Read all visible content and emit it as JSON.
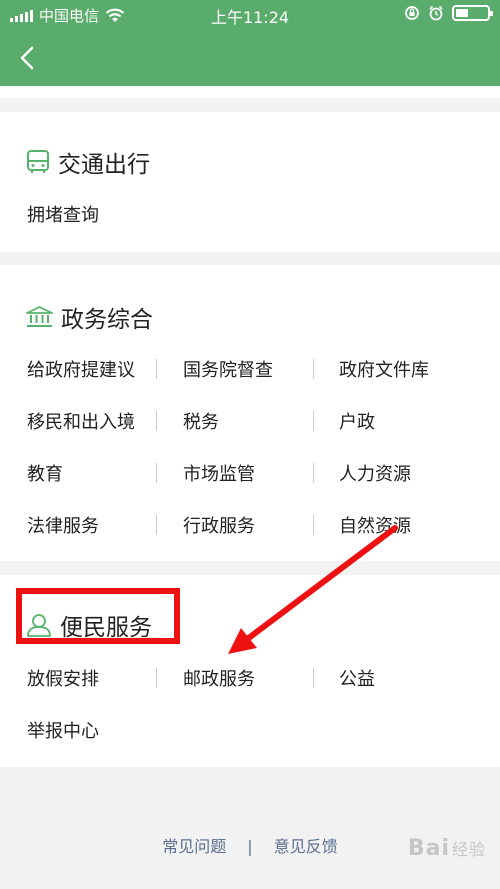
{
  "status_bar": {
    "carrier": "中国电信",
    "time": "上午11:24",
    "battery_level": 0.4
  },
  "sections": {
    "traffic": {
      "title": "交通出行",
      "items": [
        "拥堵查询"
      ]
    },
    "gov": {
      "title": "政务综合",
      "items": [
        "给政府提建议",
        "国务院督查",
        "政府文件库",
        "移民和出入境",
        "税务",
        "户政",
        "教育",
        "市场监管",
        "人力资源",
        "法律服务",
        "行政服务",
        "自然资源"
      ]
    },
    "civil": {
      "title": "便民服务",
      "items": [
        "放假安排",
        "邮政服务",
        "公益",
        "举报中心"
      ]
    }
  },
  "footer": {
    "faq": "常见问题",
    "separator": "|",
    "feedback": "意见反馈"
  },
  "watermark": {
    "text": "Bai",
    "suffix": "经验"
  },
  "colors": {
    "header_green": "#5aac6d",
    "icon_green": "#56b26a",
    "annotation_red": "#ee1111",
    "footer_link": "#5b6f94"
  },
  "icons": [
    "back-chevron-icon",
    "bus-icon",
    "government-building-icon",
    "person-icon",
    "wifi-icon",
    "lock-rotation-icon",
    "alarm-icon",
    "battery-icon",
    "signal-icon"
  ]
}
